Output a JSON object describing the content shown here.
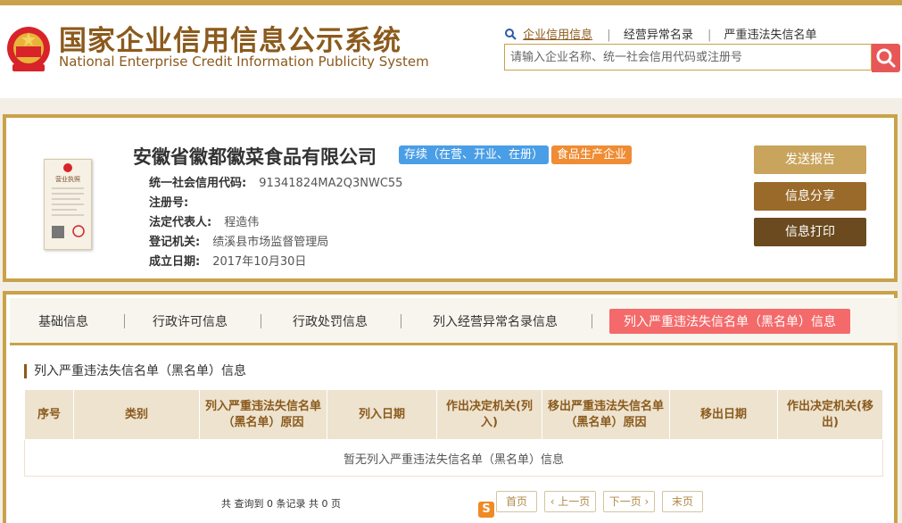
{
  "site": {
    "title_cn": "国家企业信用信息公示系统",
    "title_en": "National Enterprise Credit Information Publicity System"
  },
  "search": {
    "tabs": [
      "企业信用信息",
      "经营异常名录",
      "严重违法失信名单"
    ],
    "placeholder": "请输入企业名称、统一社会信用代码或注册号",
    "icon": "search-icon"
  },
  "company": {
    "name": "安徽省徽都徽菜食品有限公司",
    "status_badge": "存续（在营、开业、在册）",
    "type_badge": "食品生产企业",
    "license_heading": "营业执照",
    "fields": [
      {
        "label": "统一社会信用代码:",
        "value": "91341824MA2Q3NWC55"
      },
      {
        "label": "注册号:",
        "value": ""
      },
      {
        "label": "法定代表人:",
        "value": "程造伟"
      },
      {
        "label": "登记机关:",
        "value": "绩溪县市场监督管理局"
      },
      {
        "label": "成立日期:",
        "value": "2017年10月30日"
      }
    ]
  },
  "actions": [
    "发送报告",
    "信息分享",
    "信息打印"
  ],
  "colors": {
    "gold": "#c9a24a",
    "brown": "#8b5a1c",
    "active_tab": "#f46a6a",
    "status_blue": "#4a9ee6",
    "type_orange": "#ef8c34"
  },
  "tabs": [
    "基础信息",
    "行政许可信息",
    "行政处罚信息",
    "列入经营异常名录信息",
    "列入严重违法失信名单（黑名单）信息"
  ],
  "section": {
    "title": "列入严重违法失信名单（黑名单）信息",
    "columns": [
      "序号",
      "类别",
      "列入严重违法失信名单（黑名单）原因",
      "列入日期",
      "作出决定机关(列入)",
      "移出严重违法失信名单（黑名单）原因",
      "移出日期",
      "作出决定机关(移出)"
    ],
    "empty_text": "暂无列入严重违法失信名单（黑名单）信息"
  },
  "pager": {
    "info": "共 查询到 0 条记录 共 0 页",
    "first": "首页",
    "prev": "‹ 上一页",
    "next": "下一页 ›",
    "last": "末页"
  },
  "ime": {
    "label": "S"
  }
}
